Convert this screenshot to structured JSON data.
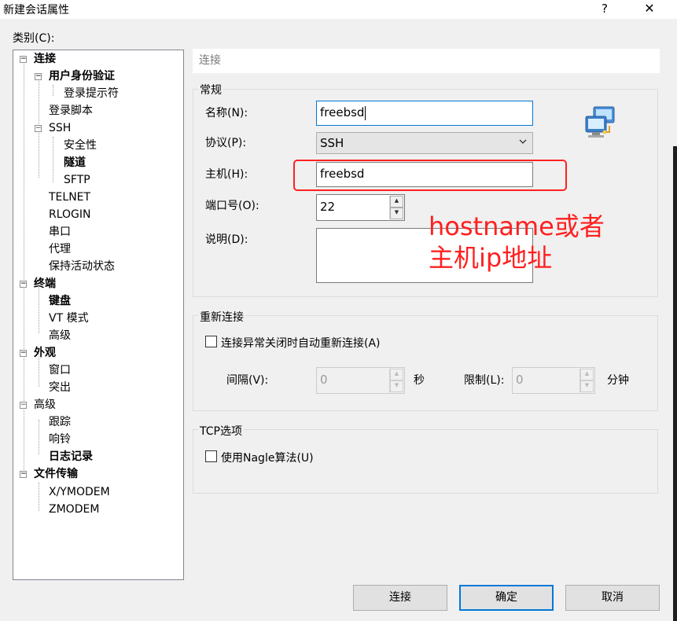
{
  "window": {
    "title": "新建会话属性",
    "help_glyph": "?",
    "close_glyph": "✕"
  },
  "category_label": "类别(C):",
  "tree": {
    "items": [
      {
        "label": "连接",
        "bold": true
      },
      {
        "label": "用户身份验证",
        "bold": true
      },
      {
        "label": "登录提示符",
        "bold": false
      },
      {
        "label": "登录脚本",
        "bold": false
      },
      {
        "label": "SSH",
        "bold": false
      },
      {
        "label": "安全性",
        "bold": false
      },
      {
        "label": "隧道",
        "bold": true
      },
      {
        "label": "SFTP",
        "bold": false
      },
      {
        "label": "TELNET",
        "bold": false
      },
      {
        "label": "RLOGIN",
        "bold": false
      },
      {
        "label": "串口",
        "bold": false
      },
      {
        "label": "代理",
        "bold": false
      },
      {
        "label": "保持活动状态",
        "bold": false
      },
      {
        "label": "终端",
        "bold": true
      },
      {
        "label": "键盘",
        "bold": true
      },
      {
        "label": "VT 模式",
        "bold": false
      },
      {
        "label": "高级",
        "bold": false
      },
      {
        "label": "外观",
        "bold": true
      },
      {
        "label": "窗口",
        "bold": false
      },
      {
        "label": "突出",
        "bold": false
      },
      {
        "label": "高级",
        "bold": false
      },
      {
        "label": "跟踪",
        "bold": false
      },
      {
        "label": "响铃",
        "bold": false
      },
      {
        "label": "日志记录",
        "bold": true
      },
      {
        "label": "文件传输",
        "bold": true
      },
      {
        "label": "X/YMODEM",
        "bold": false
      },
      {
        "label": "ZMODEM",
        "bold": false
      }
    ]
  },
  "panel": {
    "header": "连接",
    "general": {
      "title": "常规",
      "name_label": "名称(N):",
      "name_value": "freebsd",
      "protocol_label": "协议(P):",
      "protocol_value": "SSH",
      "host_label": "主机(H):",
      "host_value": "freebsd",
      "port_label": "端口号(O):",
      "port_value": "22",
      "desc_label": "说明(D):",
      "desc_value": ""
    },
    "reconnect": {
      "title": "重新连接",
      "checkbox_label": "连接异常关闭时自动重新连接(A)",
      "checked": false,
      "interval_label": "间隔(V):",
      "interval_value": "0",
      "interval_unit": "秒",
      "limit_label": "限制(L):",
      "limit_value": "0",
      "limit_unit": "分钟"
    },
    "tcp": {
      "title": "TCP选项",
      "nagle_label": "使用Nagle算法(U)",
      "checked": false
    }
  },
  "buttons": {
    "connect": "连接",
    "ok": "确定",
    "cancel": "取消"
  },
  "annotation": {
    "line1": "hostname或者",
    "line2": "主机ip地址",
    "color": "#ff2020"
  },
  "icons": {
    "session": "network-computers-icon",
    "dropdown": "chevron-down-icon"
  }
}
